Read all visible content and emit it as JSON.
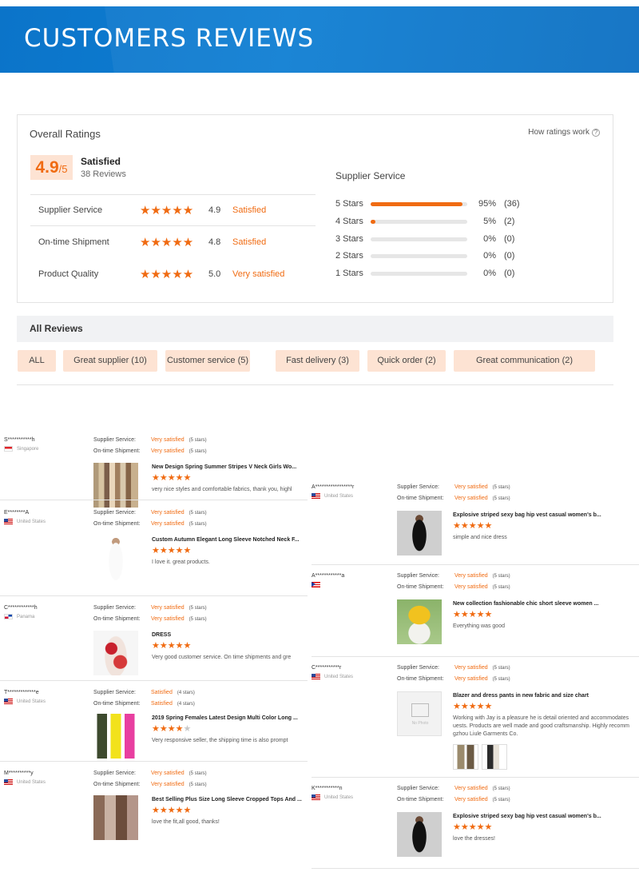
{
  "banner": {
    "title": "CUSTOMERS REVIEWS"
  },
  "ratings": {
    "title": "Overall Ratings",
    "how_link": "How ratings work",
    "help_glyph": "?",
    "score": "4.9",
    "score_max": "/5",
    "summary": "Satisfied",
    "review_count": "38 Reviews",
    "rows": [
      {
        "label": "Supplier Service",
        "stars": "★★★★★",
        "value": "4.9",
        "text": "Satisfied"
      },
      {
        "label": "On-time Shipment",
        "stars": "★★★★★",
        "value": "4.8",
        "text": "Satisfied"
      },
      {
        "label": "Product Quality",
        "stars": "★★★★★",
        "value": "5.0",
        "text": "Very satisfied"
      }
    ],
    "breakdown_title": "Supplier Service",
    "breakdown": [
      {
        "label": "5 Stars",
        "fraction": 0.95,
        "pct": "95%",
        "count": "(36)"
      },
      {
        "label": "4 Stars",
        "fraction": 0.05,
        "pct": "5%",
        "count": "(2)"
      },
      {
        "label": "3 Stars",
        "fraction": 0,
        "pct": "0%",
        "count": "(0)"
      },
      {
        "label": "2 Stars",
        "fraction": 0,
        "pct": "0%",
        "count": "(0)"
      },
      {
        "label": "1 Stars",
        "fraction": 0,
        "pct": "0%",
        "count": "(0)"
      }
    ],
    "accent_color": "#f06b12"
  },
  "all_reviews": {
    "title": "All Reviews",
    "tags": [
      "ALL",
      "Great supplier (10)",
      "Customer service (5)",
      "Fast delivery (3)",
      "Quick order (2)",
      "Great communication (2)"
    ]
  },
  "review_labels": {
    "service": "Supplier Service:",
    "shipment": "On-time Shipment:",
    "no_photo": "No Photo"
  },
  "reviews_left": [
    {
      "user": "S***********h",
      "country": "Singapore",
      "flag": "flag-sg",
      "service": "Very satisfied",
      "service_stars": "(5 stars)",
      "shipment": "Very satisfied",
      "shipment_stars": "(5 stars)",
      "product": "New Design Spring Summer Stripes V Neck Girls Wo...",
      "rating": 5,
      "comment": "very nice styles and comfortable fabrics, thank you, highl"
    },
    {
      "user": "E********A",
      "country": "United States",
      "flag": "flag-us",
      "service": "Very satisfied",
      "service_stars": "(5 stars)",
      "shipment": "Very satisfied",
      "shipment_stars": "(5 stars)",
      "product": "Custom Autumn Elegant Long Sleeve Notched Neck F...",
      "rating": 5,
      "comment": "I love it. great products."
    },
    {
      "user": "C************h",
      "country": "Panama",
      "flag": "flag-pa",
      "service": "Very satisfied",
      "service_stars": "(5 stars)",
      "shipment": "Very satisfied",
      "shipment_stars": "(5 stars)",
      "product": "DRESS",
      "rating": 5,
      "comment": "Very good customer service. On time shipments and gre"
    },
    {
      "user": "T*************e",
      "country": "United States",
      "flag": "flag-us",
      "service": "Satisfied",
      "service_stars": "(4 stars)",
      "shipment": "Satisfied",
      "shipment_stars": "(4 stars)",
      "product": "2019 Spring Females Latest Design Multi Color Long ...",
      "rating": 4,
      "comment": "Very responsive seller, the shipping time is also prompt"
    },
    {
      "user": "M**********y",
      "country": "United States",
      "flag": "flag-us",
      "service": "Very satisfied",
      "service_stars": "(5 stars)",
      "shipment": "Very satisfied",
      "shipment_stars": "(5 stars)",
      "product": "Best Selling Plus Size Long Sleeve Cropped Tops And ...",
      "rating": 5,
      "comment": "love the fit,all good, thanks!"
    }
  ],
  "reviews_right": [
    {
      "user": "A*****************r",
      "country": "United States",
      "flag": "flag-us",
      "service": "Very satisfied",
      "service_stars": "(5 stars)",
      "shipment": "Very satisfied",
      "shipment_stars": "(5 stars)",
      "product": "Explosive striped sexy bag hip vest casual women's b...",
      "rating": 5,
      "comment": "simple and nice dress",
      "comment2": ""
    },
    {
      "user": "A************a",
      "country": "",
      "flag": "flag-pr",
      "service": "Very satisfied",
      "service_stars": "(5 stars)",
      "shipment": "Very satisfied",
      "shipment_stars": "(5 stars)",
      "product": "New collection fashionable chic short sleeve women ...",
      "rating": 5,
      "comment": "Everything was good",
      "comment2": ""
    },
    {
      "user": "C***********r",
      "country": "United States",
      "flag": "flag-us",
      "service": "Very satisfied",
      "service_stars": "(5 stars)",
      "shipment": "Very satisfied",
      "shipment_stars": "(5 stars)",
      "product": "Blazer and dress pants in new fabric and size chart",
      "rating": 5,
      "comment": "Working with Jay is a pleasure he is detail oriented and accommodates",
      "comment2": "uests. Products are well made and good craftsmanship. Highly recomm",
      "comment3": "gzhou Liule Garments Co."
    },
    {
      "user": "K***********n",
      "country": "United States",
      "flag": "flag-us",
      "service": "Very satisfied",
      "service_stars": "(5 stars)",
      "shipment": "Very satisfied",
      "shipment_stars": "(5 stars)",
      "product": "Explosive striped sexy bag hip vest casual women's b...",
      "rating": 5,
      "comment": "love the dresses!",
      "comment2": ""
    }
  ]
}
